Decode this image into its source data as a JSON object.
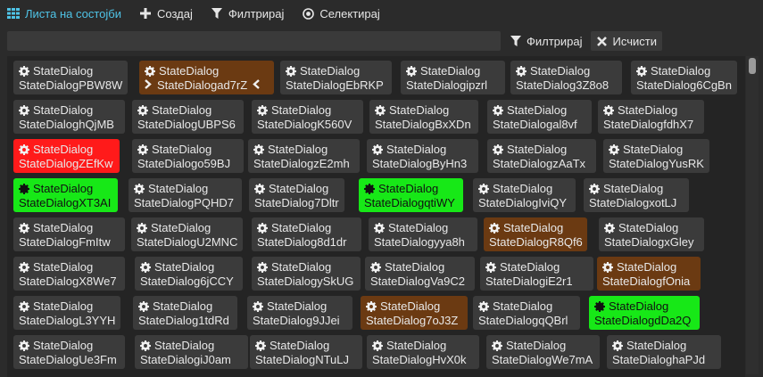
{
  "toolbar": {
    "list_label": "Листа на состојби",
    "create_label": "Создај",
    "filter_label": "Филтрирај",
    "select_label": "Селектирај"
  },
  "filter": {
    "value": "",
    "filter_button": "Филтрирај",
    "clear_button": "Исчисти"
  },
  "tiles": [
    {
      "type": "StateDialog",
      "name": "StateDialogPBW8W",
      "state": "normal"
    },
    {
      "type": "StateDialog",
      "name": "StateDialogad7rZ",
      "state": "brown"
    },
    {
      "type": "StateDialog",
      "name": "StateDialogEbRKP",
      "state": "normal"
    },
    {
      "type": "StateDialog",
      "name": "StateDialogipzrl",
      "state": "normal"
    },
    {
      "type": "StateDialog",
      "name": "StateDialog3Z8o8",
      "state": "normal"
    },
    {
      "type": "StateDialog",
      "name": "StateDialog6CgBn",
      "state": "normal"
    },
    {
      "type": "StateDialog",
      "name": "StateDialoghQjMB",
      "state": "normal"
    },
    {
      "type": "StateDialog",
      "name": "StateDialogUBPS6",
      "state": "normal"
    },
    {
      "type": "StateDialog",
      "name": "StateDialogK560V",
      "state": "normal"
    },
    {
      "type": "StateDialog",
      "name": "StateDialogBxXDn",
      "state": "normal"
    },
    {
      "type": "StateDialog",
      "name": "StateDialogal8vf",
      "state": "normal"
    },
    {
      "type": "StateDialog",
      "name": "StateDialogfdhX7",
      "state": "normal"
    },
    {
      "type": "StateDialog",
      "name": "StateDialogZEfKw",
      "state": "red"
    },
    {
      "type": "StateDialog",
      "name": "StateDialogo59BJ",
      "state": "normal"
    },
    {
      "type": "StateDialog",
      "name": "StateDialogzE2mh",
      "state": "normal"
    },
    {
      "type": "StateDialog",
      "name": "StateDialogByHn3",
      "state": "normal"
    },
    {
      "type": "StateDialog",
      "name": "StateDialogzAaTx",
      "state": "normal"
    },
    {
      "type": "StateDialog",
      "name": "StateDialogYusRK",
      "state": "normal"
    },
    {
      "type": "StateDialog",
      "name": "StateDialogXT3AI",
      "state": "green"
    },
    {
      "type": "StateDialog",
      "name": "StateDialogPQHD7",
      "state": "normal"
    },
    {
      "type": "StateDialog",
      "name": "StateDialog7Dltr",
      "state": "normal"
    },
    {
      "type": "StateDialog",
      "name": "StateDialogqtiWY",
      "state": "green"
    },
    {
      "type": "StateDialog",
      "name": "StateDialogIviQY",
      "state": "normal"
    },
    {
      "type": "StateDialog",
      "name": "StateDialogxotLJ",
      "state": "normal"
    },
    {
      "type": "StateDialog",
      "name": "StateDialogFmItw",
      "state": "normal"
    },
    {
      "type": "StateDialog",
      "name": "StateDialogU2MNC",
      "state": "normal"
    },
    {
      "type": "StateDialog",
      "name": "StateDialog8d1dr",
      "state": "normal"
    },
    {
      "type": "StateDialog",
      "name": "StateDialogyya8h",
      "state": "normal"
    },
    {
      "type": "StateDialog",
      "name": "StateDialogR8Qf6",
      "state": "brown"
    },
    {
      "type": "StateDialog",
      "name": "StateDialogxGley",
      "state": "normal"
    },
    {
      "type": "StateDialog",
      "name": "StateDialogX8We7",
      "state": "normal"
    },
    {
      "type": "StateDialog",
      "name": "StateDialog6jCCY",
      "state": "normal"
    },
    {
      "type": "StateDialog",
      "name": "StateDialogySkUG",
      "state": "normal"
    },
    {
      "type": "StateDialog",
      "name": "StateDialogVa9C2",
      "state": "normal"
    },
    {
      "type": "StateDialog",
      "name": "StateDialogiE2r1",
      "state": "normal"
    },
    {
      "type": "StateDialog",
      "name": "StateDialogfOnia",
      "state": "brown"
    },
    {
      "type": "StateDialog",
      "name": "StateDialogL3YYH",
      "state": "normal"
    },
    {
      "type": "StateDialog",
      "name": "StateDialog1tdRd",
      "state": "normal"
    },
    {
      "type": "StateDialog",
      "name": "StateDialog9JJei",
      "state": "normal"
    },
    {
      "type": "StateDialog",
      "name": "StateDialog7oJ3Z",
      "state": "brown"
    },
    {
      "type": "StateDialog",
      "name": "StateDialogqQBrl",
      "state": "normal"
    },
    {
      "type": "StateDialog",
      "name": "StateDialogdDa2Q",
      "state": "green"
    },
    {
      "type": "StateDialog",
      "name": "StateDialogUe3Fm",
      "state": "normal"
    },
    {
      "type": "StateDialog",
      "name": "StateDialogiJ0am",
      "state": "normal"
    },
    {
      "type": "StateDialog",
      "name": "StateDialogNTuLJ",
      "state": "normal"
    },
    {
      "type": "StateDialog",
      "name": "StateDialogHvX0k",
      "state": "normal"
    },
    {
      "type": "StateDialog",
      "name": "StateDialogWe7mA",
      "state": "normal"
    },
    {
      "type": "StateDialog",
      "name": "StateDialoghaPJd",
      "state": "normal"
    }
  ],
  "colors": {
    "accent": "#4fc3e6",
    "tile_normal": "#3b3b3b",
    "tile_brown": "#6b3a12",
    "tile_red": "#ff1a1a",
    "tile_green": "#17e817"
  },
  "icons": {
    "list": "grid-icon",
    "create": "plus-icon",
    "filter": "funnel-icon",
    "select": "target-icon",
    "clear": "x-icon",
    "tile": "gear-icon",
    "selected_marker": "chevron-icons"
  }
}
